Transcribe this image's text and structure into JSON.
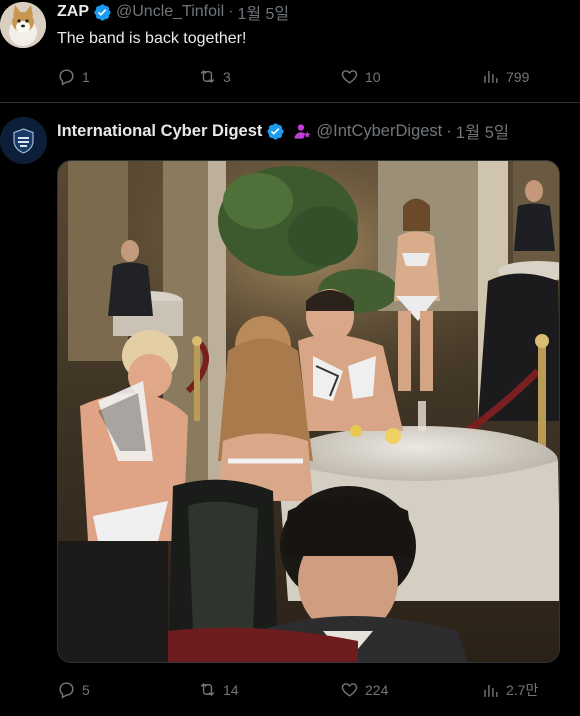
{
  "tweet1": {
    "name": "ZAP",
    "handle": "@Uncle_Tinfoil",
    "time": "1월 5일",
    "text": "The band is back together!",
    "replies": "1",
    "retweets": "3",
    "likes": "10",
    "views": "799"
  },
  "tweet2": {
    "name": "International Cyber Digest",
    "handle": "@IntCyberDigest",
    "time": "1월 5일",
    "replies": "5",
    "retweets": "14",
    "likes": "224",
    "views": "2.7만"
  },
  "colors": {
    "background": "#000000",
    "text": "#e7e9ea",
    "muted": "#71767b",
    "verified": "#1d9bf0",
    "affiliate": "#c13fd6"
  }
}
